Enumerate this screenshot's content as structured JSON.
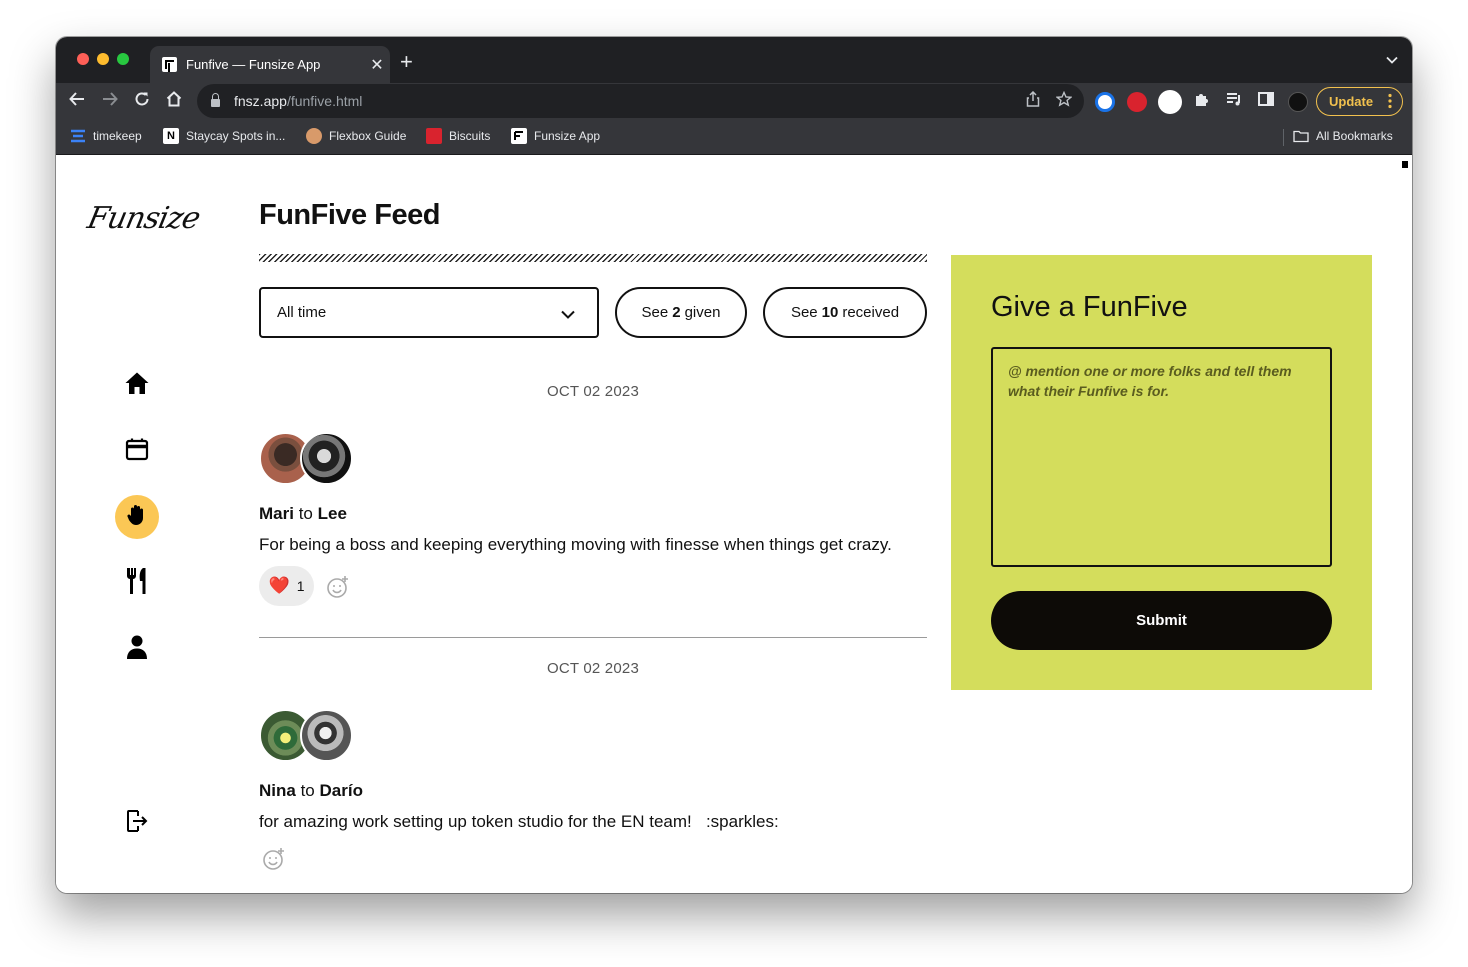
{
  "browser": {
    "tab_title": "Funfive — Funsize App",
    "tab_close": "✕",
    "new_tab": "+",
    "url_host": "fnsz.app",
    "url_path": "/funfive.html",
    "update_label": "Update",
    "bookmarks": [
      {
        "label": "timekeep",
        "color": "#3b82f6"
      },
      {
        "label": "Staycay Spots in...",
        "color": "#ffffff"
      },
      {
        "label": "Flexbox Guide",
        "color": "#d89a6a"
      },
      {
        "label": "Biscuits",
        "color": "#d9232e"
      },
      {
        "label": "Funsize App",
        "color": "#ffffff"
      }
    ],
    "all_bookmarks": "All Bookmarks"
  },
  "app": {
    "logo": "Funsize",
    "nav": [
      {
        "name": "home-icon"
      },
      {
        "name": "calendar-icon"
      },
      {
        "name": "hand-icon",
        "active": true
      },
      {
        "name": "fork-knife-icon"
      },
      {
        "name": "person-icon"
      }
    ],
    "logout_icon": "logout-icon",
    "accent_color": "#fbc755"
  },
  "feed": {
    "title": "FunFive Feed",
    "filter": {
      "selected": "All time"
    },
    "given": {
      "prefix": "See",
      "count": "2",
      "suffix": "given"
    },
    "received": {
      "prefix": "See",
      "count": "10",
      "suffix": "received"
    },
    "posts": [
      {
        "date": "OCT 02 2023",
        "from": "Mari",
        "connector": "to",
        "to": "Lee",
        "message": "For being a boss and keeping everything moving with finesse when things get crazy.",
        "reaction": {
          "emoji": "❤️",
          "count": "1"
        }
      },
      {
        "date": "OCT 02 2023",
        "from": "Nina",
        "connector": "to",
        "to": "Darío",
        "message": "for amazing work setting up token studio for the EN team!   :sparkles:"
      }
    ]
  },
  "give_panel": {
    "title": "Give a FunFive",
    "placeholder": "@ mention one or more folks and tell them what their Funfive is for.",
    "submit_label": "Submit",
    "panel_color": "#d4dd5c"
  }
}
